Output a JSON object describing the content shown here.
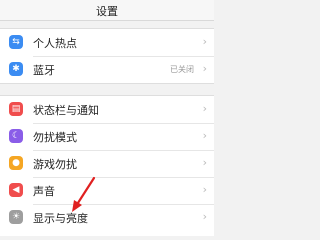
{
  "header": {
    "title": "设置"
  },
  "group1": [
    {
      "label": "个人热点",
      "icon": "hotspot-icon",
      "icon_glyph": "⇆",
      "color": "#3b8cf2",
      "status": ""
    },
    {
      "label": "蓝牙",
      "icon": "bluetooth-icon",
      "icon_glyph": "✱",
      "color": "#3b8cf2",
      "status": "已关闭"
    }
  ],
  "group2": [
    {
      "label": "状态栏与通知",
      "icon": "notifications-icon",
      "icon_glyph": "▤",
      "color": "#f04d4d"
    },
    {
      "label": "勿扰模式",
      "icon": "moon-icon",
      "icon_glyph": "☾",
      "color": "#8a5de8"
    },
    {
      "label": "游戏勿扰",
      "icon": "gamepad-icon",
      "icon_glyph": "●",
      "color": "#f5a623"
    },
    {
      "label": "声音",
      "icon": "speaker-icon",
      "icon_glyph": "◀",
      "color": "#f04d4d"
    },
    {
      "label": "显示与亮度",
      "icon": "brightness-icon",
      "icon_glyph": "☀",
      "color": "#9e9e9e"
    }
  ],
  "annotation": {
    "color": "#e02020"
  }
}
